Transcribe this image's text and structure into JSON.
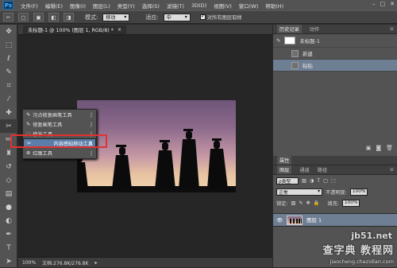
{
  "app": {
    "logo": "Ps"
  },
  "menubar": {
    "items": [
      "文件(F)",
      "编辑(E)",
      "图像(I)",
      "图层(L)",
      "类型(Y)",
      "选择(S)",
      "滤镜(T)",
      "3D(D)",
      "视图(V)",
      "窗口(W)",
      "帮助(H)"
    ],
    "window_buttons": [
      "–",
      "□",
      "✕"
    ]
  },
  "options": {
    "mode_label": "模式:",
    "mode_value": "移动",
    "adapt_label": "适应:",
    "adapt_value": "中",
    "sample_all_label": "对所有图层取样"
  },
  "document": {
    "tab_title": "未标题-1 @ 100% (图层 1, RGB/8) *",
    "tab_close": "×"
  },
  "status": {
    "zoom": "100%",
    "doc_info": "文档:276.8K/276.8K"
  },
  "flyout": {
    "items": [
      {
        "icon": "spot-healing-brush-icon",
        "label": "污点修复画笔工具",
        "key": "J"
      },
      {
        "icon": "healing-brush-icon",
        "label": "修复画笔工具",
        "key": "J"
      },
      {
        "icon": "patch-icon",
        "label": "修补工具",
        "key": "J"
      },
      {
        "icon": "content-aware-move-icon",
        "label": "内容感知移动工具",
        "key": "J"
      },
      {
        "icon": "red-eye-icon",
        "label": "红眼工具",
        "key": "J"
      }
    ],
    "selected_index": 3
  },
  "history": {
    "tabs": [
      "历史记录",
      "动作"
    ],
    "snapshot_label": "未标题-1",
    "rows": [
      "新建",
      "粘贴"
    ]
  },
  "panel_attrs": {
    "tab": "属性"
  },
  "layers": {
    "tabs": [
      "图层",
      "通道",
      "路径"
    ],
    "kind_label": "ρ类型",
    "blend_mode": "正常",
    "opacity_label": "不透明度:",
    "opacity_value": "100%",
    "lock_label": "锁定:",
    "fill_label": "填充:",
    "fill_value": "100%",
    "layer_name": "图层 1"
  },
  "watermark": {
    "site": "jb51.net",
    "brand": "查字典 教程网",
    "url": "jiaocheng.chazidian.com"
  }
}
